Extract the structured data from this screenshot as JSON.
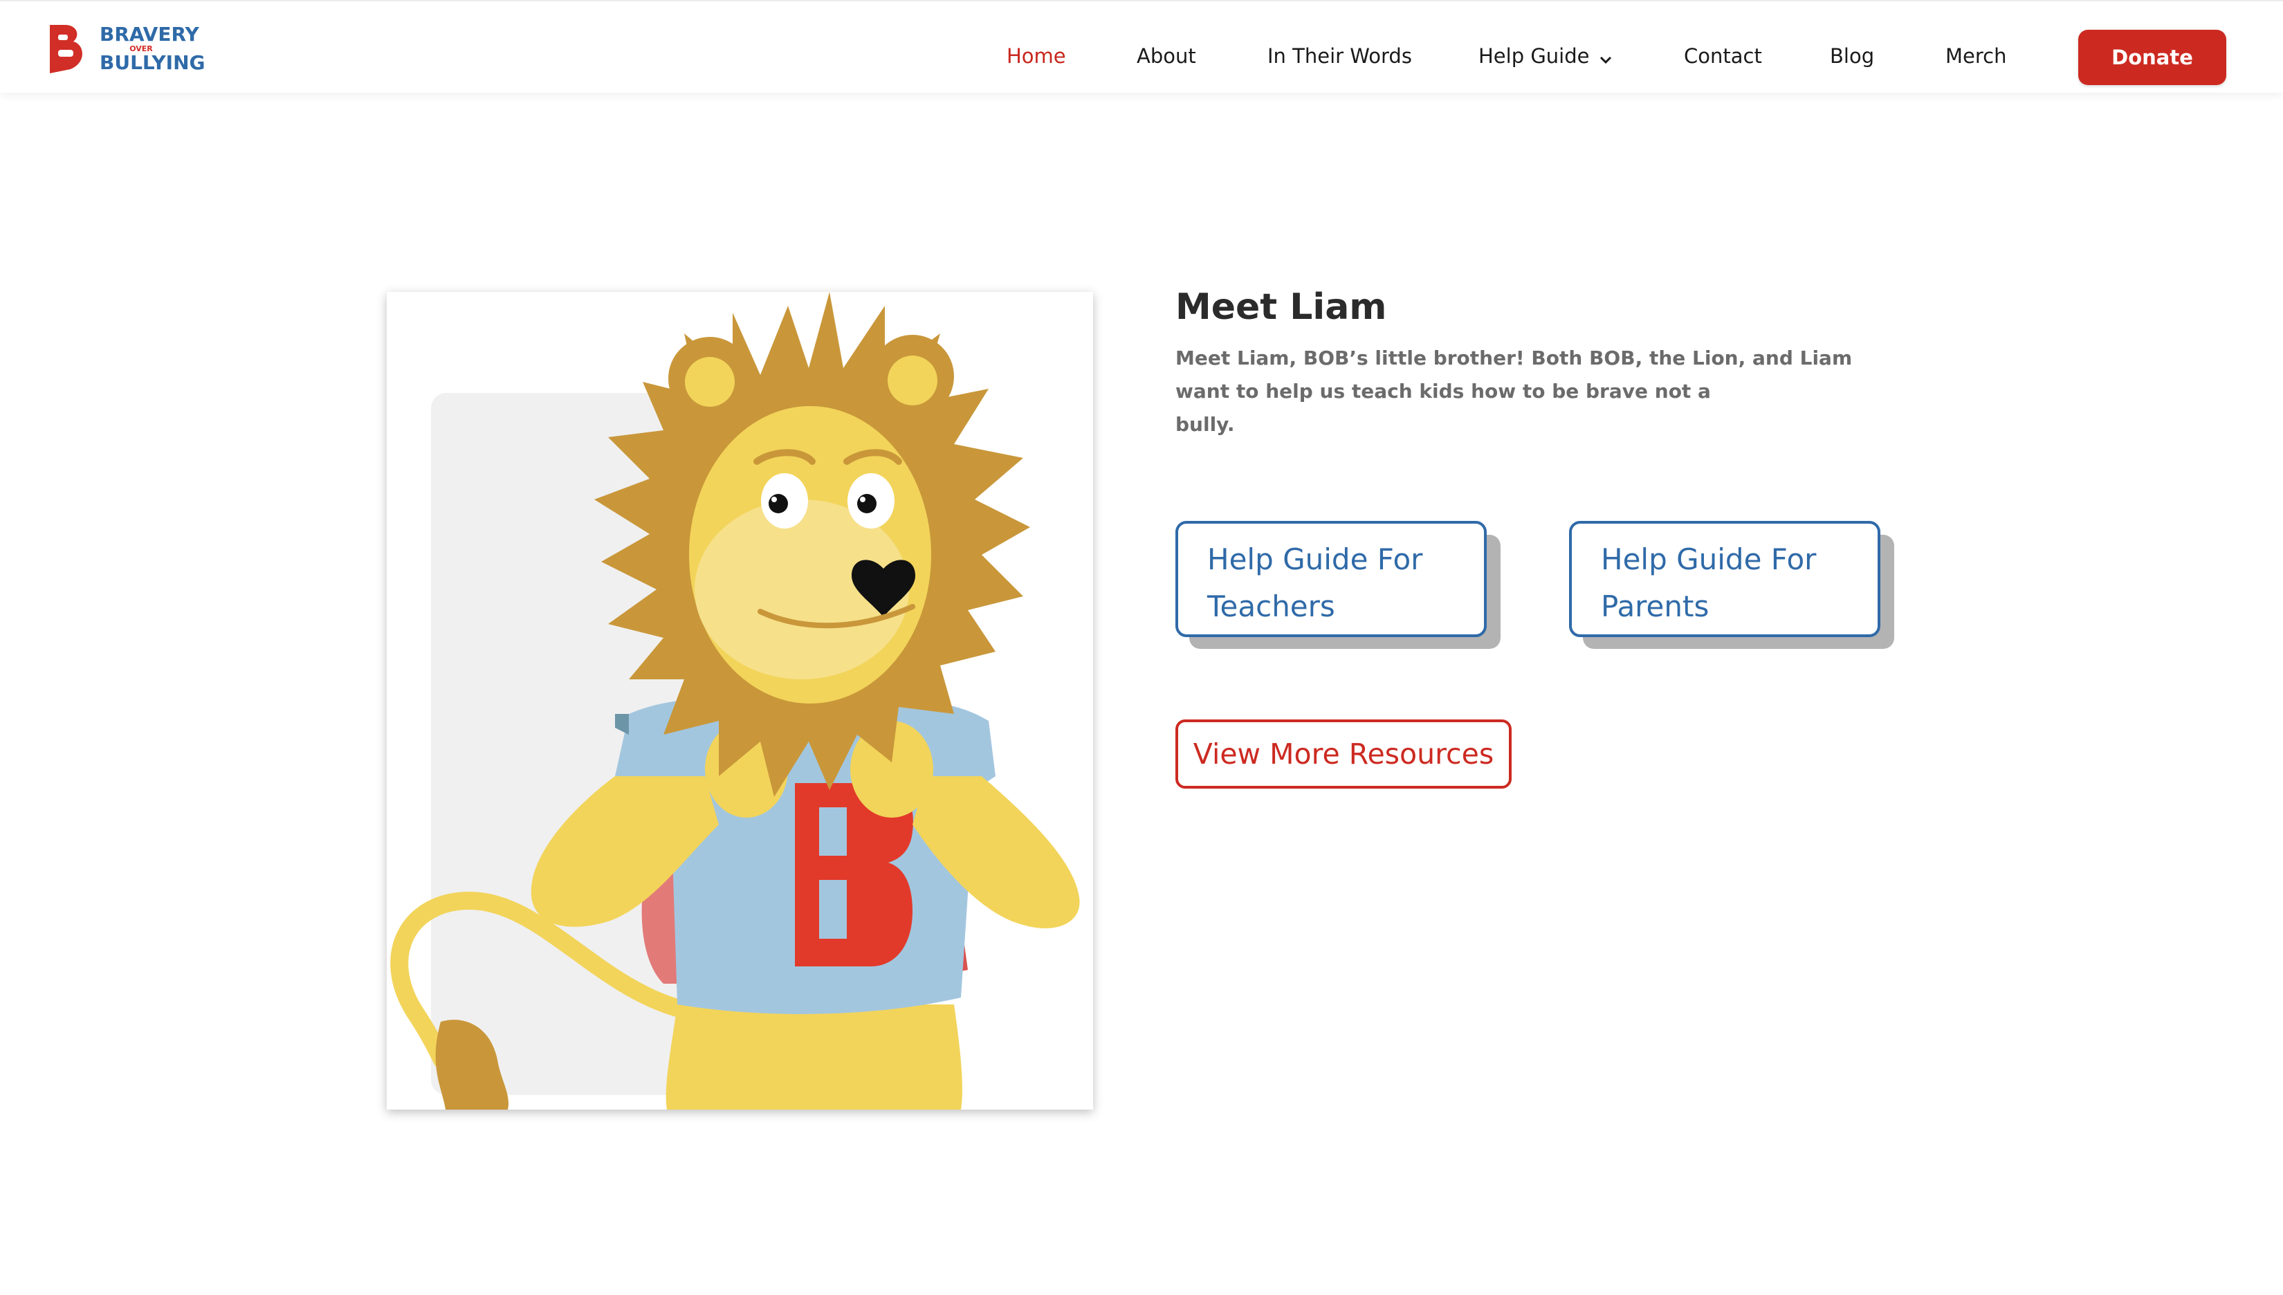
{
  "brand": {
    "logo_line1": "BRAVERY",
    "logo_over": "OVER",
    "logo_line2": "BULLYING",
    "accent_red": "#cc2a21",
    "accent_blue": "#2f6aa8"
  },
  "nav": {
    "items": [
      {
        "label": "Home",
        "active": true
      },
      {
        "label": "About"
      },
      {
        "label": "In Their Words"
      },
      {
        "label": "Help Guide",
        "has_dropdown": true,
        "icon": "chevron-down-icon"
      },
      {
        "label": "Contact"
      },
      {
        "label": "Blog"
      },
      {
        "label": "Merch"
      }
    ],
    "donate_label": "Donate"
  },
  "hero": {
    "image_subject": "lion-mascot-liam"
  },
  "content": {
    "title": "Meet Liam",
    "description_lines": [
      "Meet Liam, BOB’s little brother! Both BOB, the Lion, and Liam",
      "want to help us teach kids how to be brave not a",
      "bully."
    ],
    "teachers_button": {
      "line1": "Help Guide For",
      "line2": "Teachers"
    },
    "parents_button": {
      "line1": "Help Guide For",
      "line2": "Parents"
    },
    "resources_label": "View More Resources"
  }
}
